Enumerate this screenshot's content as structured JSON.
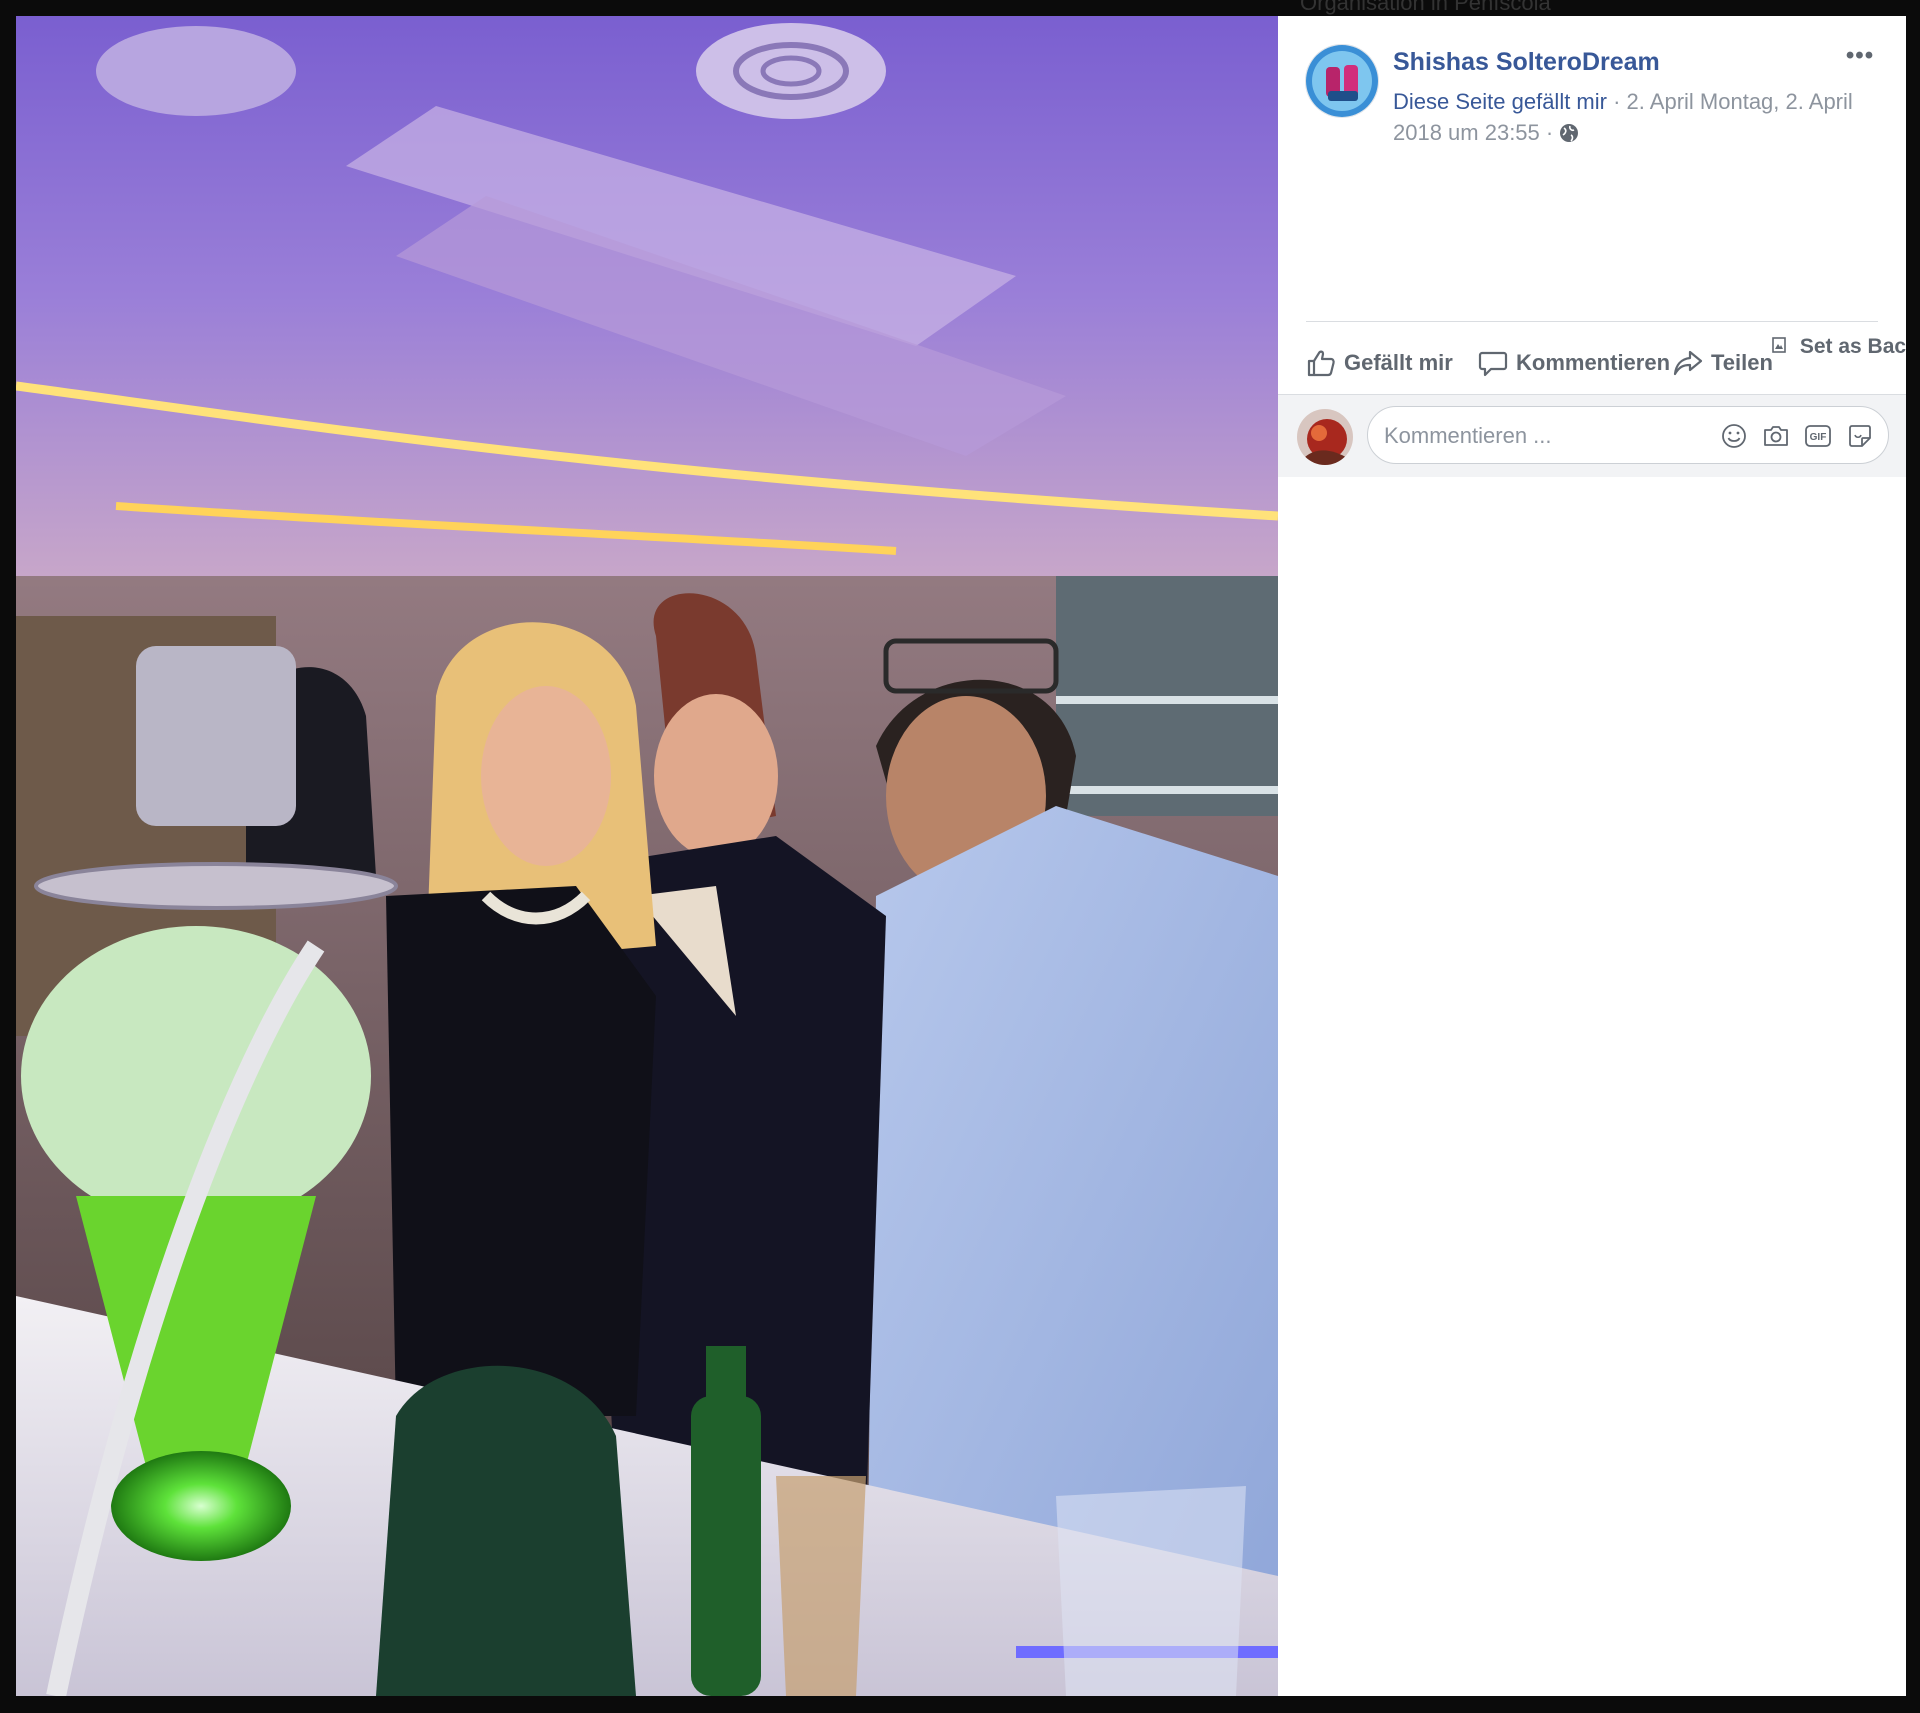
{
  "background_peek_text": "Organisation in Peñíscola",
  "post": {
    "page_name": "Shishas SolteroDream",
    "like_page_link": "Diese Seite gefällt mir",
    "separator": " · ",
    "date_line": "2. April Montag, 2. April 2018 um 23:55",
    "audience_separator": " · ",
    "audience_icon": "globe-icon",
    "more_label": "•••"
  },
  "actions": {
    "like": "Gefällt mir",
    "comment": "Kommentieren",
    "share": "Teilen",
    "set_background": "Set as Backgrou"
  },
  "comment_box": {
    "placeholder": "Kommentieren ...",
    "icons": [
      "emoji-icon",
      "camera-icon",
      "gif-icon",
      "sticker-icon"
    ],
    "gif_label": "GIF"
  },
  "colors": {
    "link": "#385898",
    "secondary_text": "#606770",
    "meta_text": "#8d949e",
    "comment_bar_bg": "#f2f3f5"
  }
}
